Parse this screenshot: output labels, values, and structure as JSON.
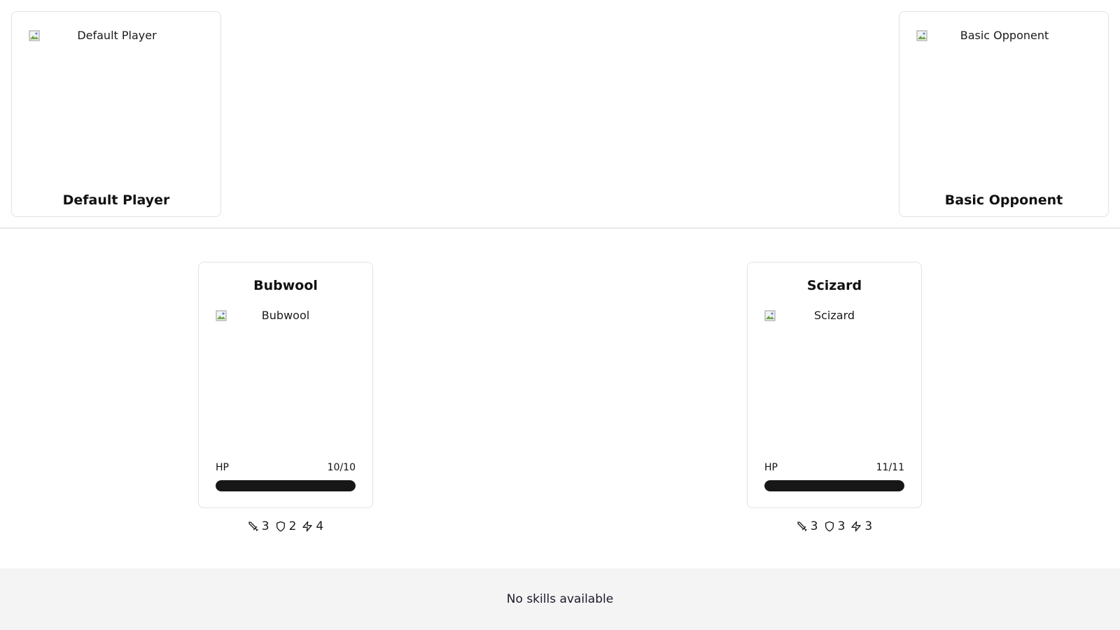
{
  "player": {
    "name": "Default Player",
    "image_alt": "Default Player"
  },
  "opponent": {
    "name": "Basic Opponent",
    "image_alt": "Basic Opponent"
  },
  "player_monster": {
    "name": "Bubwool",
    "image_alt": "Bubwool",
    "hp_label": "HP",
    "hp_text": "10/10",
    "hp_fraction": 1.0,
    "attack": "3",
    "defense": "2",
    "speed": "4"
  },
  "opponent_monster": {
    "name": "Scizard",
    "image_alt": "Scizard",
    "hp_label": "HP",
    "hp_text": "11/11",
    "hp_fraction": 1.0,
    "attack": "3",
    "defense": "3",
    "speed": "3"
  },
  "skills": {
    "empty_text": "No skills available"
  },
  "icons": {
    "attack": "sword-icon",
    "defense": "shield-icon",
    "speed": "lightning-icon",
    "broken_image": "broken-image-icon"
  },
  "colors": {
    "hp_fill": "#171717",
    "hp_track": "#e6e6e6",
    "skills_bg": "#f4f4f5"
  }
}
